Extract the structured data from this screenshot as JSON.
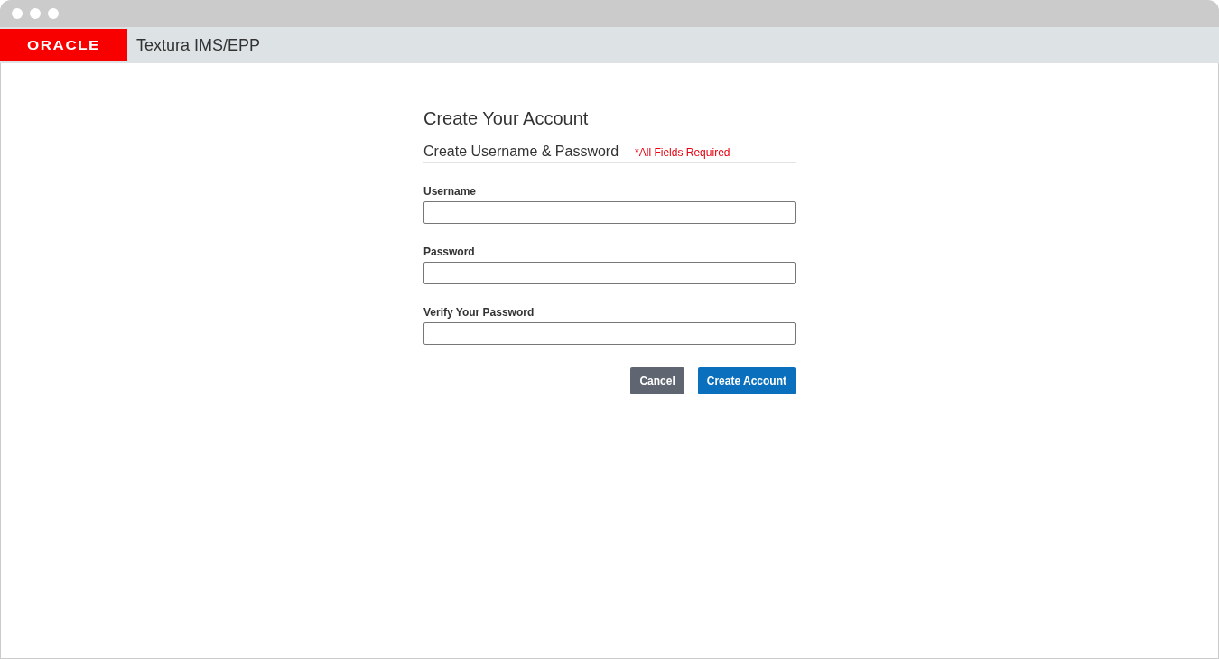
{
  "header": {
    "logo": "ORACLE",
    "app_name": "Textura IMS/EPP"
  },
  "form": {
    "title": "Create Your Account",
    "section": "Create Username & Password",
    "required_note": "*All Fields Required",
    "fields": [
      {
        "label": "Username"
      },
      {
        "label": "Password"
      },
      {
        "label": "Verify Your Password"
      }
    ],
    "buttons": [
      {
        "label": "Cancel",
        "kind": "secondary"
      },
      {
        "label": "Create Account",
        "kind": "primary"
      }
    ]
  }
}
